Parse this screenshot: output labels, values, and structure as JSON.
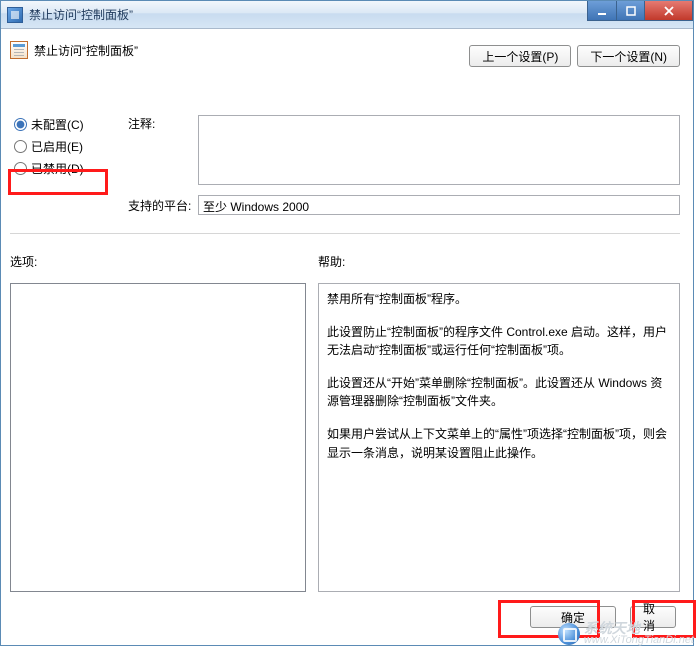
{
  "window": {
    "title": "禁止访问“控制面板”"
  },
  "header": {
    "policy_title": "禁止访问“控制面板”",
    "prev_label": "上一个设置(P)",
    "next_label": "下一个设置(N)"
  },
  "radios": {
    "not_configured": "未配置(C)",
    "enabled": "已启用(E)",
    "disabled": "已禁用(D)"
  },
  "labels": {
    "comment": "注释:",
    "supported_platform": "支持的平台:",
    "options": "选项:",
    "help": "帮助:"
  },
  "platform_value": "至少 Windows 2000",
  "help_paragraphs": [
    "禁用所有“控制面板”程序。",
    "此设置防止“控制面板”的程序文件 Control.exe 启动。这样，用户无法启动“控制面板”或运行任何“控制面板”项。",
    "此设置还从“开始”菜单删除“控制面板”。此设置还从 Windows 资源管理器删除“控制面板”文件夹。",
    "如果用户尝试从上下文菜单上的“属性”项选择“控制面板”项，则会显示一条消息，说明某设置阻止此操作。"
  ],
  "footer": {
    "ok": "确定",
    "cancel": "取消"
  },
  "watermark": {
    "text1": "系统天地",
    "text2": "www.XiTongTianDi.net"
  }
}
